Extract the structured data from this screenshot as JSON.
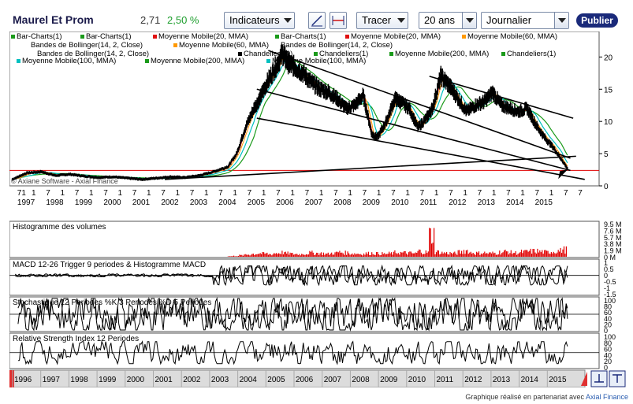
{
  "header": {
    "title": "Maurel Et Prom",
    "price": "2,71",
    "change": "2,50 %",
    "indicators_label": "Indicateurs",
    "tracer_label": "Tracer",
    "period_value": "20 ans",
    "interval_value": "Journalier",
    "publish_label": "Publier"
  },
  "credit": {
    "prefix": "Graphique réalisé en partenariat avec",
    "link": "Axial Finance"
  },
  "colors": {
    "background": "#ffffff",
    "price_line": "#000000",
    "ma20": "#e01010",
    "ma60": "#ff9900",
    "ma100": "#00c0c0",
    "ma200": "#1a9a1a",
    "volume": "#e00000",
    "reference": "#e00000"
  },
  "chart_data": [
    {
      "type": "line",
      "panel": "price",
      "legend": [
        {
          "label": "Bar-Charts(1)",
          "color": "#1a9a1a"
        },
        {
          "label": "Bar-Charts(1)",
          "color": "#1a9a1a"
        },
        {
          "label": "Moyenne Mobile(20, MMA)",
          "color": "#e01010"
        },
        {
          "label": "Bar-Charts(1)",
          "color": "#1a9a1a"
        },
        {
          "label": "Moyenne Mobile(20, MMA)",
          "color": "#e01010"
        },
        {
          "label": "Moyenne Mobile(60, MMA)",
          "color": "#ff9900"
        },
        {
          "label": "Bandes de Bollinger(14, 2, Close)",
          "color": "#ffffff"
        },
        {
          "label": "Moyenne Mobile(60, MMA)",
          "color": "#ff9900"
        },
        {
          "label": "Bandes de Bollinger(14, 2, Close)",
          "color": "#ffffff"
        },
        {
          "label": "Bandes de Bollinger(14, 2, Close)",
          "color": "#ffffff"
        },
        {
          "label": "Chandeliers(0)",
          "color": "#000000"
        },
        {
          "label": "Chandeliers(1)",
          "color": "#1a9a1a"
        },
        {
          "label": "Moyenne Mobile(200, MMA)",
          "color": "#1a9a1a"
        },
        {
          "label": "Chandeliers(1)",
          "color": "#1a9a1a"
        },
        {
          "label": "Moyenne Mobile(100, MMA)",
          "color": "#00c0c0"
        },
        {
          "label": "Moyenne Mobile(200, MMA)",
          "color": "#1a9a1a"
        },
        {
          "label": "Moyenne Mobile(100, MMA)",
          "color": "#00c0c0"
        }
      ],
      "watermark": "© Axiane Software - Axial Finance",
      "x_tick_labels": [
        "71",
        "1",
        "7",
        "1",
        "7",
        "1",
        "7",
        "1",
        "7",
        "1",
        "7",
        "1",
        "7",
        "1",
        "7",
        "1",
        "7",
        "1",
        "7",
        "1",
        "7",
        "1",
        "7",
        "1",
        "7",
        "1",
        "7",
        "1",
        "7",
        "1",
        "7",
        "1",
        "7",
        "1",
        "7",
        "1",
        "7",
        "1",
        "7",
        "7"
      ],
      "x_year_labels": [
        "1997",
        "1998",
        "1999",
        "2000",
        "2001",
        "2002",
        "2003",
        "2004",
        "2005",
        "2006",
        "2007",
        "2008",
        "2009",
        "2010",
        "2011",
        "2012",
        "2013",
        "2014",
        "2015"
      ],
      "y_ticks": [
        0,
        5,
        10,
        15,
        20
      ],
      "ylim": [
        0,
        22
      ],
      "reference_line": 2.4,
      "x": [
        1996.5,
        1997.0,
        1997.5,
        1998.0,
        1998.5,
        1999.0,
        1999.5,
        2000.0,
        2000.5,
        2001.0,
        2001.5,
        2002.0,
        2002.5,
        2003.0,
        2003.5,
        2004.0,
        2004.3,
        2004.6,
        2004.9,
        2005.1,
        2005.3,
        2005.6,
        2005.9,
        2006.1,
        2006.3,
        2006.6,
        2006.9,
        2007.2,
        2007.5,
        2007.8,
        2008.1,
        2008.4,
        2008.7,
        2009.0,
        2009.2,
        2009.5,
        2009.8,
        2010.0,
        2010.3,
        2010.6,
        2010.9,
        2011.1,
        2011.4,
        2011.7,
        2012.0,
        2012.3,
        2012.6,
        2012.9,
        2013.2,
        2013.5,
        2013.8,
        2014.1,
        2014.4,
        2014.7,
        2015.0,
        2015.3,
        2015.6,
        2015.8
      ],
      "close": [
        1.0,
        2.0,
        2.2,
        1.6,
        1.8,
        1.5,
        1.3,
        1.4,
        1.2,
        1.0,
        1.2,
        1.4,
        1.3,
        1.6,
        2.2,
        3.0,
        5.0,
        9.0,
        12.0,
        13.5,
        15.5,
        18.0,
        20.5,
        19.0,
        18.5,
        17.5,
        16.0,
        15.0,
        14.5,
        13.5,
        12.0,
        12.5,
        14.0,
        8.0,
        7.5,
        10.0,
        13.5,
        13.0,
        12.0,
        9.0,
        10.5,
        12.0,
        17.0,
        15.5,
        13.5,
        11.5,
        12.5,
        13.0,
        14.5,
        12.5,
        12.0,
        11.5,
        12.0,
        9.5,
        7.5,
        6.0,
        4.0,
        2.7
      ],
      "trendlines": [
        {
          "from": [
            2005.4,
            21.0
          ],
          "to": [
            2015.9,
            4.3
          ]
        },
        {
          "from": [
            2005.0,
            15.0
          ],
          "to": [
            2015.9,
            2.4
          ]
        },
        {
          "from": [
            2005.0,
            10.5
          ],
          "to": [
            2016.4,
            1.0
          ]
        },
        {
          "from": [
            2011.0,
            17.0
          ],
          "to": [
            2016.0,
            10.5
          ]
        },
        {
          "from": [
            2001.8,
            1.0
          ],
          "to": [
            2016.1,
            4.6
          ]
        }
      ]
    },
    {
      "type": "bar",
      "panel": "volume",
      "title": "Histogramme des volumes",
      "y_tick_labels": [
        "9.5 M",
        "7.6 M",
        "5.7 M",
        "3.8 M",
        "1.9 M",
        "0 M"
      ],
      "ylim": [
        0,
        9.5
      ],
      "x_start": 2004.0,
      "x_end": 2015.8,
      "values": [
        0.2,
        0.3,
        0.5,
        0.8,
        1.0,
        1.2,
        1.1,
        0.9,
        1.3,
        1.5,
        1.2,
        1.0,
        0.9,
        1.1,
        1.4,
        1.3,
        1.2,
        1.0,
        1.3,
        1.6,
        1.4,
        1.2,
        1.1,
        1.0,
        1.2,
        1.3,
        1.1,
        1.0,
        1.2,
        1.5,
        1.4,
        1.3,
        1.2,
        2.0,
        1.6,
        7.8,
        1.7,
        1.4,
        1.3,
        1.2,
        1.6,
        2.2,
        1.5,
        1.3,
        1.4,
        1.2,
        1.3,
        1.6,
        1.8,
        1.5,
        1.4,
        1.7,
        1.9,
        2.0,
        1.8,
        1.6,
        1.9,
        2.1,
        2.5
      ]
    },
    {
      "type": "line",
      "panel": "macd",
      "title": "MACD 12-26   Trigger 9 periodes & Histogramme MACD",
      "y_tick_labels": [
        "1",
        "0.5",
        "0",
        "-0.5",
        "-1",
        "-1.5"
      ],
      "ylim": [
        -1.5,
        1
      ],
      "start_year": 2003.5,
      "end_year": 2015.8
    },
    {
      "type": "line",
      "panel": "stochastic",
      "title": "Stochastique 12 Periodes  %K 3 Periodes  %D 5 Periodes",
      "y_tick_labels": [
        "100",
        "80",
        "60",
        "40",
        "20",
        "0"
      ],
      "ylim": [
        0,
        100
      ]
    },
    {
      "type": "line",
      "panel": "rsi",
      "title": "Relative Strength Index 12 Periodes",
      "y_tick_labels": [
        "100",
        "80",
        "60",
        "40",
        "20",
        "0"
      ],
      "ylim": [
        0,
        100
      ]
    }
  ],
  "navigator": {
    "years": [
      "1996",
      "1997",
      "1998",
      "1999",
      "2000",
      "2001",
      "2002",
      "2003",
      "2004",
      "2005",
      "2006",
      "2007",
      "2008",
      "2009",
      "2010",
      "2011",
      "2012",
      "2013",
      "2014",
      "2015"
    ]
  }
}
